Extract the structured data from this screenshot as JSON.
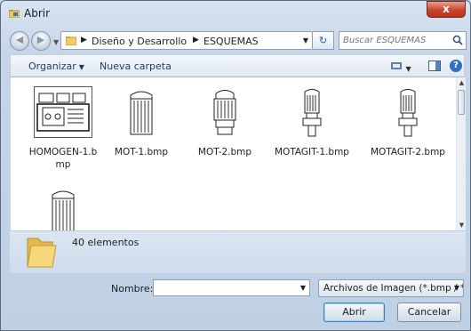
{
  "window": {
    "title": "Abrir",
    "close_label": "x"
  },
  "address": {
    "segments": [
      "Diseño y Desarrollo",
      "ESQUEMAS"
    ],
    "search_placeholder": "Buscar ESQUEMAS"
  },
  "toolbar": {
    "organize_label": "Organizar",
    "new_folder_label": "Nueva carpeta"
  },
  "files": [
    {
      "name": "HOMOGEN-1.bmp",
      "type": "homogen"
    },
    {
      "name": "MOT-1.bmp",
      "type": "mot1"
    },
    {
      "name": "MOT-2.bmp",
      "type": "mot2"
    },
    {
      "name": "MOTAGIT-1.bmp",
      "type": "motagit"
    },
    {
      "name": "MOTAGIT-2.bmp",
      "type": "motagit"
    },
    {
      "name": "",
      "type": "mot1"
    }
  ],
  "details": {
    "count_text": "40 elementos"
  },
  "footer": {
    "name_label": "Nombre:",
    "name_value": "",
    "filetype": "Archivos de Imagen (*.bmp / *.",
    "open_label": "Abrir",
    "cancel_label": "Cancelar"
  },
  "colors": {
    "accent": "#2f6fc7",
    "window_bg": "#c6d5e8",
    "close": "#c8452d"
  }
}
